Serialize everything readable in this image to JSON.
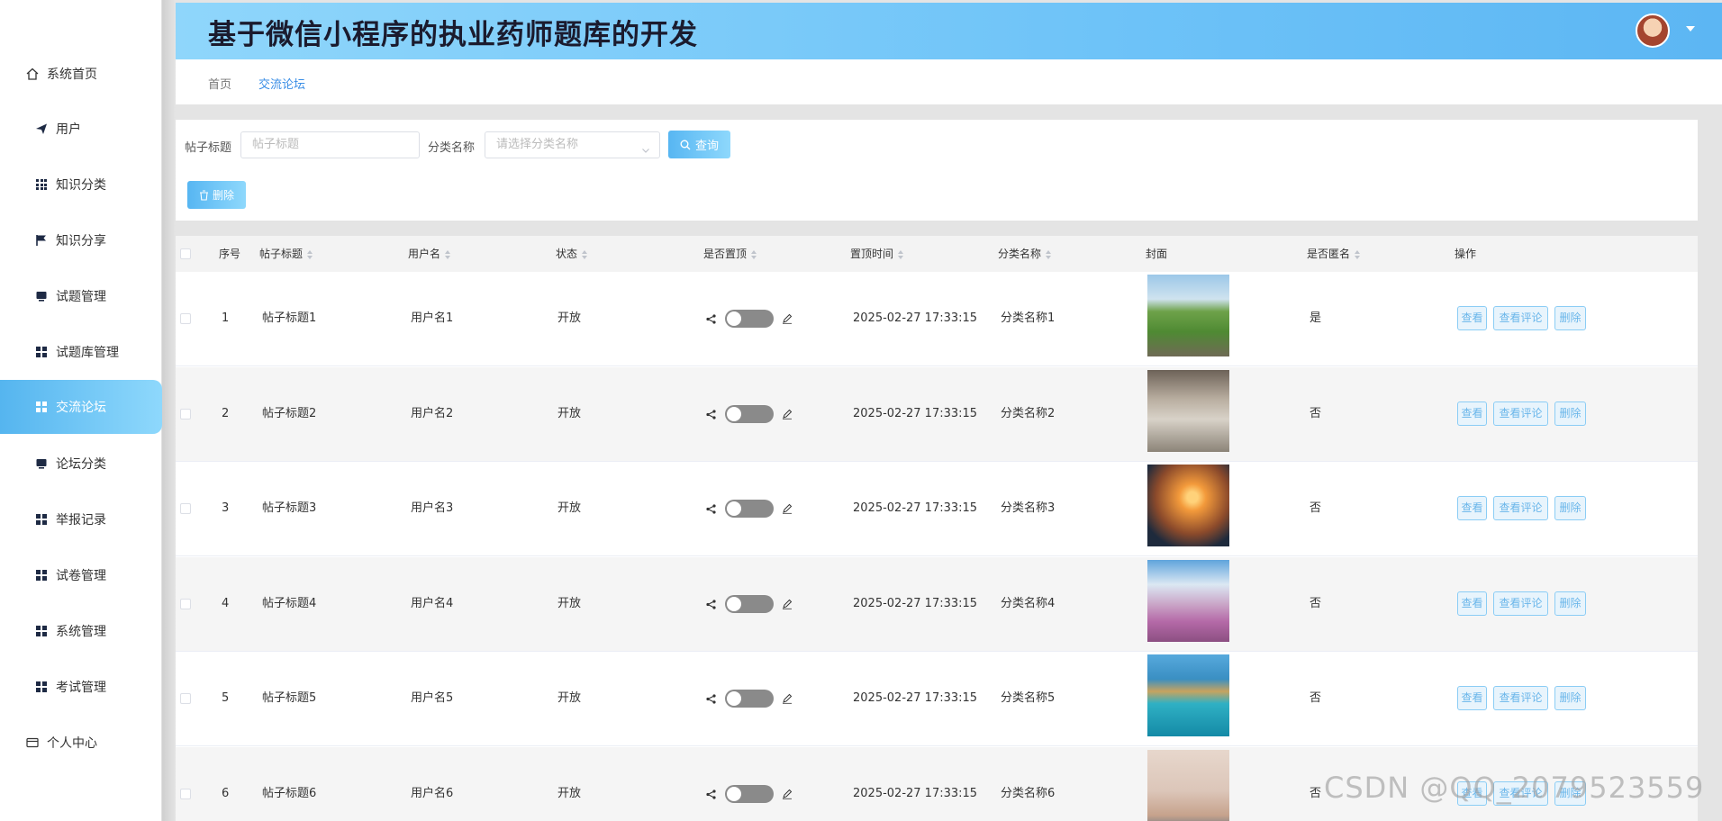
{
  "app": {
    "title": "基于微信小程序的执业药师题库的开发"
  },
  "sidebar": {
    "items": [
      {
        "label": "系统首页",
        "icon": "home-icon"
      },
      {
        "label": "用户",
        "icon": "send-icon"
      },
      {
        "label": "知识分类",
        "icon": "grid-icon"
      },
      {
        "label": "知识分享",
        "icon": "flag-icon"
      },
      {
        "label": "试题管理",
        "icon": "monitor-icon"
      },
      {
        "label": "试题库管理",
        "icon": "apps-icon"
      },
      {
        "label": "交流论坛",
        "icon": "apps-icon",
        "active": true
      },
      {
        "label": "论坛分类",
        "icon": "monitor-icon"
      },
      {
        "label": "举报记录",
        "icon": "apps-icon"
      },
      {
        "label": "试卷管理",
        "icon": "apps-icon"
      },
      {
        "label": "系统管理",
        "icon": "apps-icon"
      },
      {
        "label": "考试管理",
        "icon": "apps-icon"
      },
      {
        "label": "个人中心",
        "icon": "card-icon"
      }
    ]
  },
  "breadcrumb": {
    "home": "首页",
    "current": "交流论坛"
  },
  "search": {
    "title_label": "帖子标题",
    "title_placeholder": "帖子标题",
    "category_label": "分类名称",
    "category_placeholder": "请选择分类名称",
    "query_button": "查询",
    "delete_button": "删除"
  },
  "table": {
    "headers": {
      "index": "序号",
      "title": "帖子标题",
      "username": "用户名",
      "status": "状态",
      "pinned": "是否置顶",
      "pin_time": "置顶时间",
      "category": "分类名称",
      "cover": "封面",
      "anonymous": "是否匿名",
      "actions": "操作"
    },
    "rows": [
      {
        "index": "1",
        "title": "帖子标题1",
        "username": "用户名1",
        "status": "开放",
        "pinned": false,
        "pin_time": "2025-02-27 17:33:15",
        "category": "分类名称1",
        "cover": "river-landscape",
        "anonymous": "是"
      },
      {
        "index": "2",
        "title": "帖子标题2",
        "username": "用户名2",
        "status": "开放",
        "pinned": false,
        "pin_time": "2025-02-27 17:33:15",
        "category": "分类名称2",
        "cover": "library-glasses",
        "anonymous": "否"
      },
      {
        "index": "3",
        "title": "帖子标题3",
        "username": "用户名3",
        "status": "开放",
        "pinned": false,
        "pin_time": "2025-02-27 17:33:15",
        "category": "分类名称3",
        "cover": "sunset-sea",
        "anonymous": "否"
      },
      {
        "index": "4",
        "title": "帖子标题4",
        "username": "用户名4",
        "status": "开放",
        "pinned": false,
        "pin_time": "2025-02-27 17:33:15",
        "category": "分类名称4",
        "cover": "mount-fuji-blossoms",
        "anonymous": "否"
      },
      {
        "index": "5",
        "title": "帖子标题5",
        "username": "用户名5",
        "status": "开放",
        "pinned": false,
        "pin_time": "2025-02-27 17:33:15",
        "category": "分类名称5",
        "cover": "sea-rocks",
        "anonymous": "否"
      },
      {
        "index": "6",
        "title": "帖子标题6",
        "username": "用户名6",
        "status": "开放",
        "pinned": false,
        "pin_time": "2025-02-27 17:33:15",
        "category": "分类名称6",
        "cover": "books-desk",
        "anonymous": "否"
      }
    ],
    "actions": {
      "view": "查看",
      "view_comments": "查看评论",
      "delete": "删除"
    }
  },
  "watermark": "CSDN @QQ_2079523559",
  "colors": {
    "accent": "#6ec3f8",
    "accent_light": "#8ed8fc",
    "title_text": "#1b1b2e"
  }
}
